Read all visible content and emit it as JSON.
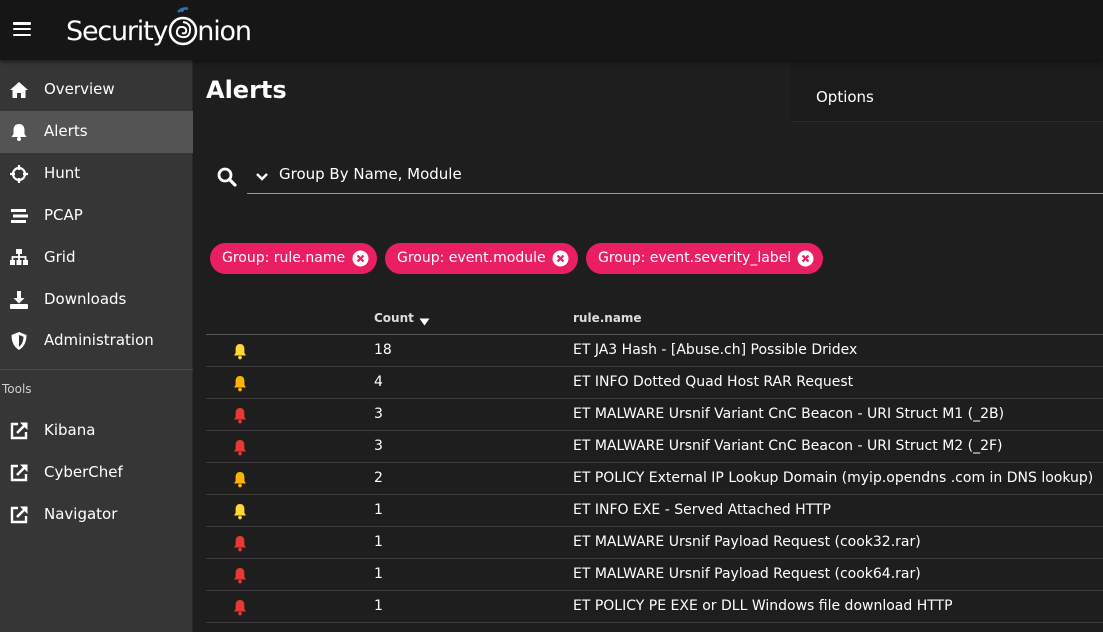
{
  "app": {
    "logo_text": "Security",
    "logo_suffix": "nion"
  },
  "sidebar": {
    "items": [
      {
        "label": "Overview",
        "icon": "home-icon"
      },
      {
        "label": "Alerts",
        "icon": "bell-icon",
        "active": true
      },
      {
        "label": "Hunt",
        "icon": "crosshairs-icon"
      },
      {
        "label": "PCAP",
        "icon": "stream-icon"
      },
      {
        "label": "Grid",
        "icon": "sitemap-icon"
      },
      {
        "label": "Downloads",
        "icon": "download-icon"
      },
      {
        "label": "Administration",
        "icon": "shield-icon"
      }
    ],
    "tools_label": "Tools",
    "tools": [
      {
        "label": "Kibana",
        "icon": "external-link-icon"
      },
      {
        "label": "CyberChef",
        "icon": "external-link-icon"
      },
      {
        "label": "Navigator",
        "icon": "external-link-icon"
      }
    ]
  },
  "page": {
    "title": "Alerts",
    "options_label": "Options"
  },
  "search": {
    "query": "Group By Name, Module"
  },
  "chips": [
    {
      "label": "Group: rule.name"
    },
    {
      "label": "Group: event.module"
    },
    {
      "label": "Group: event.severity_label"
    }
  ],
  "table": {
    "headers": {
      "count": "Count",
      "rule": "rule.name"
    },
    "rows": [
      {
        "severity": "medium",
        "count": "18",
        "rule": "ET JA3 Hash - [Abuse.ch] Possible Dridex"
      },
      {
        "severity": "low",
        "count": "4",
        "rule": "ET INFO Dotted Quad Host RAR Request"
      },
      {
        "severity": "high",
        "count": "3",
        "rule": "ET MALWARE Ursnif Variant CnC Beacon - URI Struct M1 (_2B)"
      },
      {
        "severity": "high",
        "count": "3",
        "rule": "ET MALWARE Ursnif Variant CnC Beacon - URI Struct M2 (_2F)"
      },
      {
        "severity": "low",
        "count": "2",
        "rule": "ET POLICY External IP Lookup Domain (myip.opendns .com in DNS lookup)"
      },
      {
        "severity": "medium",
        "count": "1",
        "rule": "ET INFO EXE - Served Attached HTTP"
      },
      {
        "severity": "high",
        "count": "1",
        "rule": "ET MALWARE Ursnif Payload Request (cook32.rar)"
      },
      {
        "severity": "high",
        "count": "1",
        "rule": "ET MALWARE Ursnif Payload Request (cook64.rar)"
      },
      {
        "severity": "high",
        "count": "1",
        "rule": "ET POLICY PE EXE or DLL Windows file download HTTP"
      }
    ]
  },
  "colors": {
    "chip": "#e91e63",
    "severity_high": "#e53935",
    "severity_medium": "#fdd835",
    "severity_low": "#ffb300"
  }
}
